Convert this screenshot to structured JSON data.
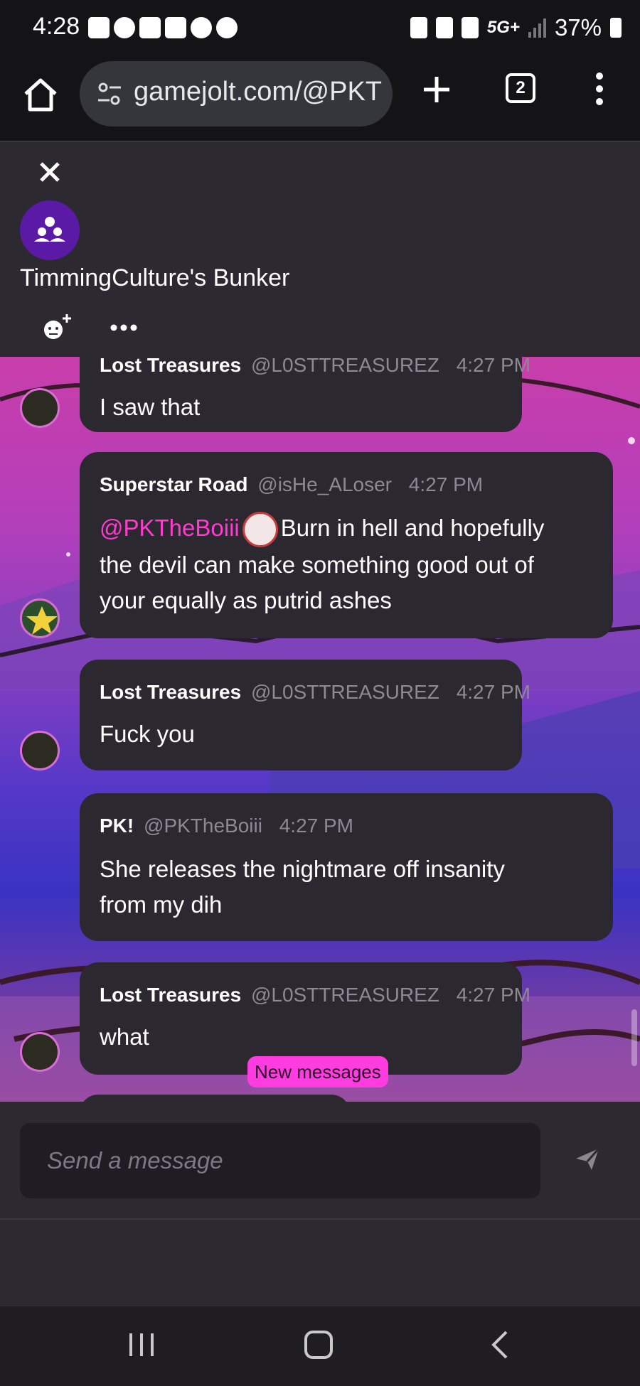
{
  "status_bar": {
    "time": "4:28",
    "network": "5G+",
    "battery": "37%"
  },
  "browser": {
    "url": "gamejolt.com/@PKT",
    "tab_count": "2"
  },
  "chat": {
    "room_title": "TimmingCulture's Bunker",
    "messages": [
      {
        "name": "Lost Treasures",
        "handle": "@L0STTREASUREZ",
        "time": "4:27 PM",
        "text": "I saw that"
      },
      {
        "name": "Superstar Road",
        "handle": "@isHe_ALoser",
        "time": "4:27 PM",
        "mention": "@PKTheBoiii",
        "text_line1": "Burn in hell and hopefully",
        "text_line2": "the devil can make something good out of",
        "text_line3": "your equally as putrid ashes"
      },
      {
        "name": "Lost Treasures",
        "handle": "@L0STTREASUREZ",
        "time": "4:27 PM",
        "text": "Fuck you"
      },
      {
        "name": "PK!",
        "handle": "@PKTheBoiii",
        "time": "4:27 PM",
        "text_line1": "She releases the nightmare off insanity",
        "text_line2": "from my dih"
      },
      {
        "name": "Lost Treasures",
        "handle": "@L0STTREASUREZ",
        "time": "4:27 PM",
        "text": "what"
      }
    ],
    "new_messages_label": "New messages"
  },
  "composer": {
    "placeholder": "Send a message"
  },
  "icons": {
    "home": "home-icon",
    "site_settings": "tune-icon",
    "new_tab": "plus-icon",
    "menu": "kebab-menu-icon",
    "close": "close-icon",
    "room": "group-icon",
    "add_member": "add-member-icon",
    "more": "more-icon",
    "send": "send-icon"
  },
  "colors": {
    "accent_pink": "#ff3cdf",
    "mention": "#ff3ccf",
    "room_avatar": "#5a1aa6",
    "bubble": "#2b2830"
  }
}
